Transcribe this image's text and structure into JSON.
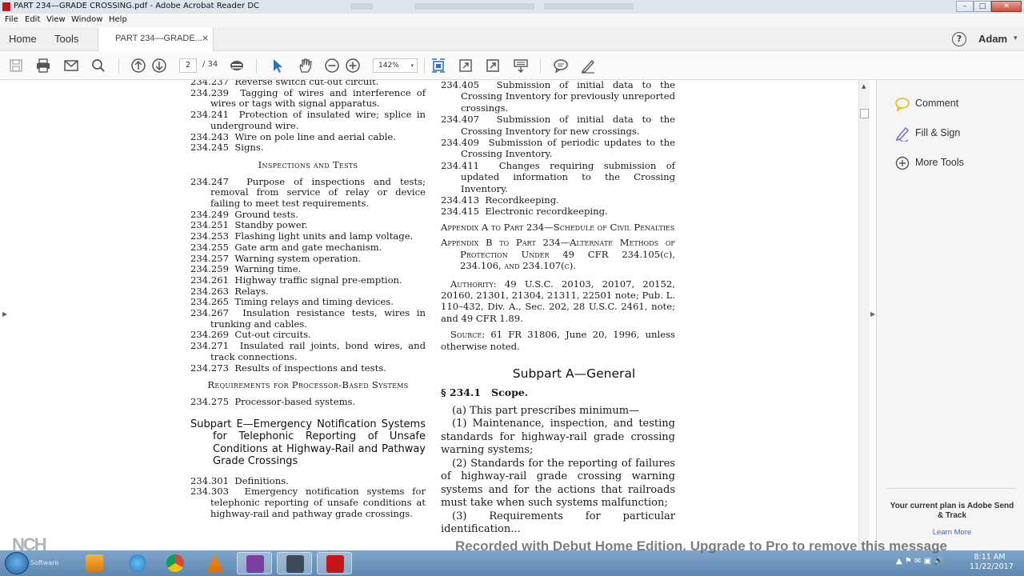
{
  "window": {
    "title": "PART 234—GRADE CROSSING.pdf - Adobe Acrobat Reader DC",
    "controls": {
      "minimize": "–",
      "maximize": "□",
      "close": "✕"
    }
  },
  "menu": [
    "File",
    "Edit",
    "View",
    "Window",
    "Help"
  ],
  "header": {
    "home": "Home",
    "tools": "Tools",
    "doc_tab": "PART 234—GRADE...",
    "tab_close": "×",
    "help": "?",
    "user": "Adam",
    "user_caret": "▾"
  },
  "toolbar": {
    "page_current": "2",
    "page_total": "/ 34",
    "zoom": "142%",
    "zoom_caret": "▾"
  },
  "doc": {
    "left": {
      "items1": [
        {
          "num": "234.237",
          "text": "Reverse switch cut-out circuit."
        },
        {
          "num": "234.239",
          "text": "Tagging of wires and interference of wires or tags with signal apparatus."
        },
        {
          "num": "234.241",
          "text": "Protection of insulated wire; splice in underground wire."
        },
        {
          "num": "234.243",
          "text": "Wire on pole line and aerial cable."
        },
        {
          "num": "234.245",
          "text": "Signs."
        }
      ],
      "heading1": "Inspections and Tests",
      "items2": [
        {
          "num": "234.247",
          "text": "Purpose of inspections and tests; removal from service of relay or device failing to meet test requirements."
        },
        {
          "num": "234.249",
          "text": "Ground tests."
        },
        {
          "num": "234.251",
          "text": "Standby power."
        },
        {
          "num": "234.253",
          "text": "Flashing light units and lamp voltage."
        },
        {
          "num": "234.255",
          "text": "Gate arm and gate mechanism."
        },
        {
          "num": "234.257",
          "text": "Warning system operation."
        },
        {
          "num": "234.259",
          "text": "Warning time."
        },
        {
          "num": "234.261",
          "text": "Highway traffic signal pre-emption."
        },
        {
          "num": "234.263",
          "text": "Relays."
        },
        {
          "num": "234.265",
          "text": "Timing relays and timing devices."
        },
        {
          "num": "234.267",
          "text": "Insulation resistance tests, wires in trunking and cables."
        },
        {
          "num": "234.269",
          "text": "Cut-out circuits."
        },
        {
          "num": "234.271",
          "text": "Insulated rail joints, bond wires, and track connections."
        },
        {
          "num": "234.273",
          "text": "Results of inspections and tests."
        }
      ],
      "heading2": "Requirements for Processor-Based Systems",
      "items3": [
        {
          "num": "234.275",
          "text": "Processor-based systems."
        }
      ],
      "subpart_e": "Subpart E—Emergency Notification Systems for Telephonic Reporting of Unsafe Conditions at Highway-Rail and Pathway Grade Crossings",
      "items4": [
        {
          "num": "234.301",
          "text": "Definitions."
        },
        {
          "num": "234.303",
          "text": "Emergency notification systems for telephonic reporting of unsafe conditions at highway-rail and pathway grade crossings."
        }
      ]
    },
    "middle": {
      "items": [
        {
          "num": "234.405",
          "text": "Submission of initial data to the Crossing Inventory for previously unreported crossings."
        },
        {
          "num": "234.407",
          "text": "Submission of initial data to the Crossing Inventory for new crossings."
        },
        {
          "num": "234.409",
          "text": "Submission of periodic updates to the Crossing Inventory."
        },
        {
          "num": "234.411",
          "text": "Changes requiring submission of updated information to the Crossing Inventory."
        },
        {
          "num": "234.413",
          "text": "Recordkeeping."
        },
        {
          "num": "234.415",
          "text": "Electronic recordkeeping."
        }
      ],
      "appendix_a": "Appendix A to Part 234—Schedule of Civil Penalties",
      "appendix_b": "Appendix B to Part 234—Alternate Methods of Protection Under 49 CFR 234.105(c), 234.106, and 234.107(c).",
      "authority_label": "Authority:",
      "authority_text": "49 U.S.C. 20103, 20107, 20152, 20160, 21301, 21304, 21311, 22501 note; Pub. L. 110–432, Div. A., Sec. 202, 28 U.S.C. 2461, note; and 49 CFR 1.89.",
      "source_label": "Source:",
      "source_text": "61 FR 31806, June 20, 1996, unless otherwise noted.",
      "subpart_a": "Subpart A—General",
      "section": "§ 234.1",
      "section_title": "Scope.",
      "para_a": "(a) This part prescribes minimum—",
      "para_1": "(1) Maintenance, inspection, and testing standards for highway-rail grade crossing warning systems;",
      "para_2": "(2) Standards for the reporting of failures of highway-rail grade crossing warning systems and for the actions that railroads must take when such systems malfunction;",
      "para_3": "(3) Requirements for particular identification..."
    }
  },
  "right_panel": {
    "comment": "Comment",
    "fill_sign": "Fill & Sign",
    "more_tools": "More Tools",
    "plan": "Your current plan is Adobe Send & Track",
    "learn_more": "Learn More"
  },
  "watermark": "Recorded with Debut Home Edition. Upgrade to Pro to remove this message",
  "nch": {
    "logo": "NCH",
    "software": "Software"
  },
  "taskbar": {
    "time": "8:11 AM",
    "date": "11/22/2017",
    "tray": "▲ ⚑ ✉ ▣ 🔊"
  },
  "colors": {
    "accent": "#2d6ec9",
    "acrobat_red": "#c4171b",
    "comment_yellow": "#f0b323",
    "fill_purple": "#7a6fc9"
  }
}
